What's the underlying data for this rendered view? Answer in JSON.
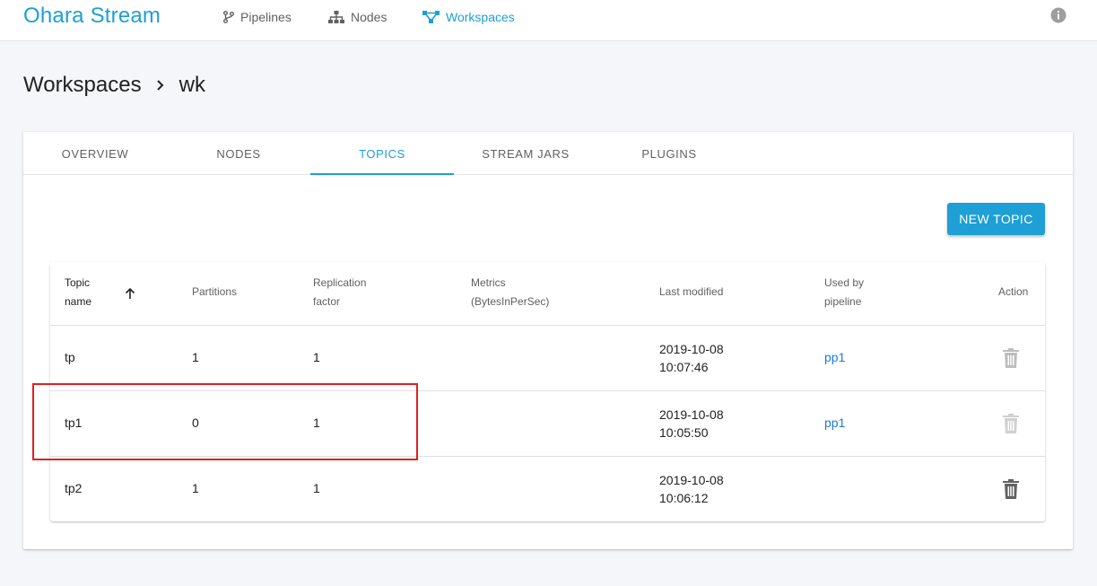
{
  "header": {
    "brand": "Ohara Stream",
    "nav": [
      {
        "label": "Pipelines",
        "icon": "branch-icon"
      },
      {
        "label": "Nodes",
        "icon": "sitemap-icon"
      },
      {
        "label": "Workspaces",
        "icon": "workspaces-icon",
        "active": true
      }
    ],
    "info_icon": "info-icon"
  },
  "breadcrumb": {
    "parent": "Workspaces",
    "current": "wk"
  },
  "tabs": [
    {
      "label": "OVERVIEW"
    },
    {
      "label": "NODES"
    },
    {
      "label": "TOPICS",
      "active": true
    },
    {
      "label": "STREAM JARS"
    },
    {
      "label": "PLUGINS"
    }
  ],
  "actions": {
    "new_topic_label": "NEW TOPIC"
  },
  "table": {
    "columns": {
      "topic_name_1": "Topic",
      "topic_name_2": "name",
      "partitions": "Partitions",
      "replication_1": "Replication",
      "replication_2": "factor",
      "metrics_1": "Metrics",
      "metrics_2": "(BytesInPerSec)",
      "last_modified": "Last modified",
      "used_by_1": "Used by",
      "used_by_2": "pipeline",
      "action": "Action"
    },
    "rows": [
      {
        "name": "tp",
        "partitions": "1",
        "replication": "1",
        "date": "2019-10-08",
        "time": "10:07:46",
        "pipeline": "pp1",
        "delete_enabled": false
      },
      {
        "name": "tp1",
        "partitions": "0",
        "replication": "1",
        "date": "2019-10-08",
        "time": "10:05:50",
        "pipeline": "pp1",
        "delete_enabled": false
      },
      {
        "name": "tp2",
        "partitions": "1",
        "replication": "1",
        "date": "2019-10-08",
        "time": "10:06:12",
        "pipeline": "",
        "delete_enabled": true
      }
    ]
  },
  "colors": {
    "accent": "#1e9fd6",
    "link": "#1e7ad6",
    "highlight": "#e02020",
    "trash_disabled": "#bdbdbd",
    "trash_enabled": "#616161"
  }
}
